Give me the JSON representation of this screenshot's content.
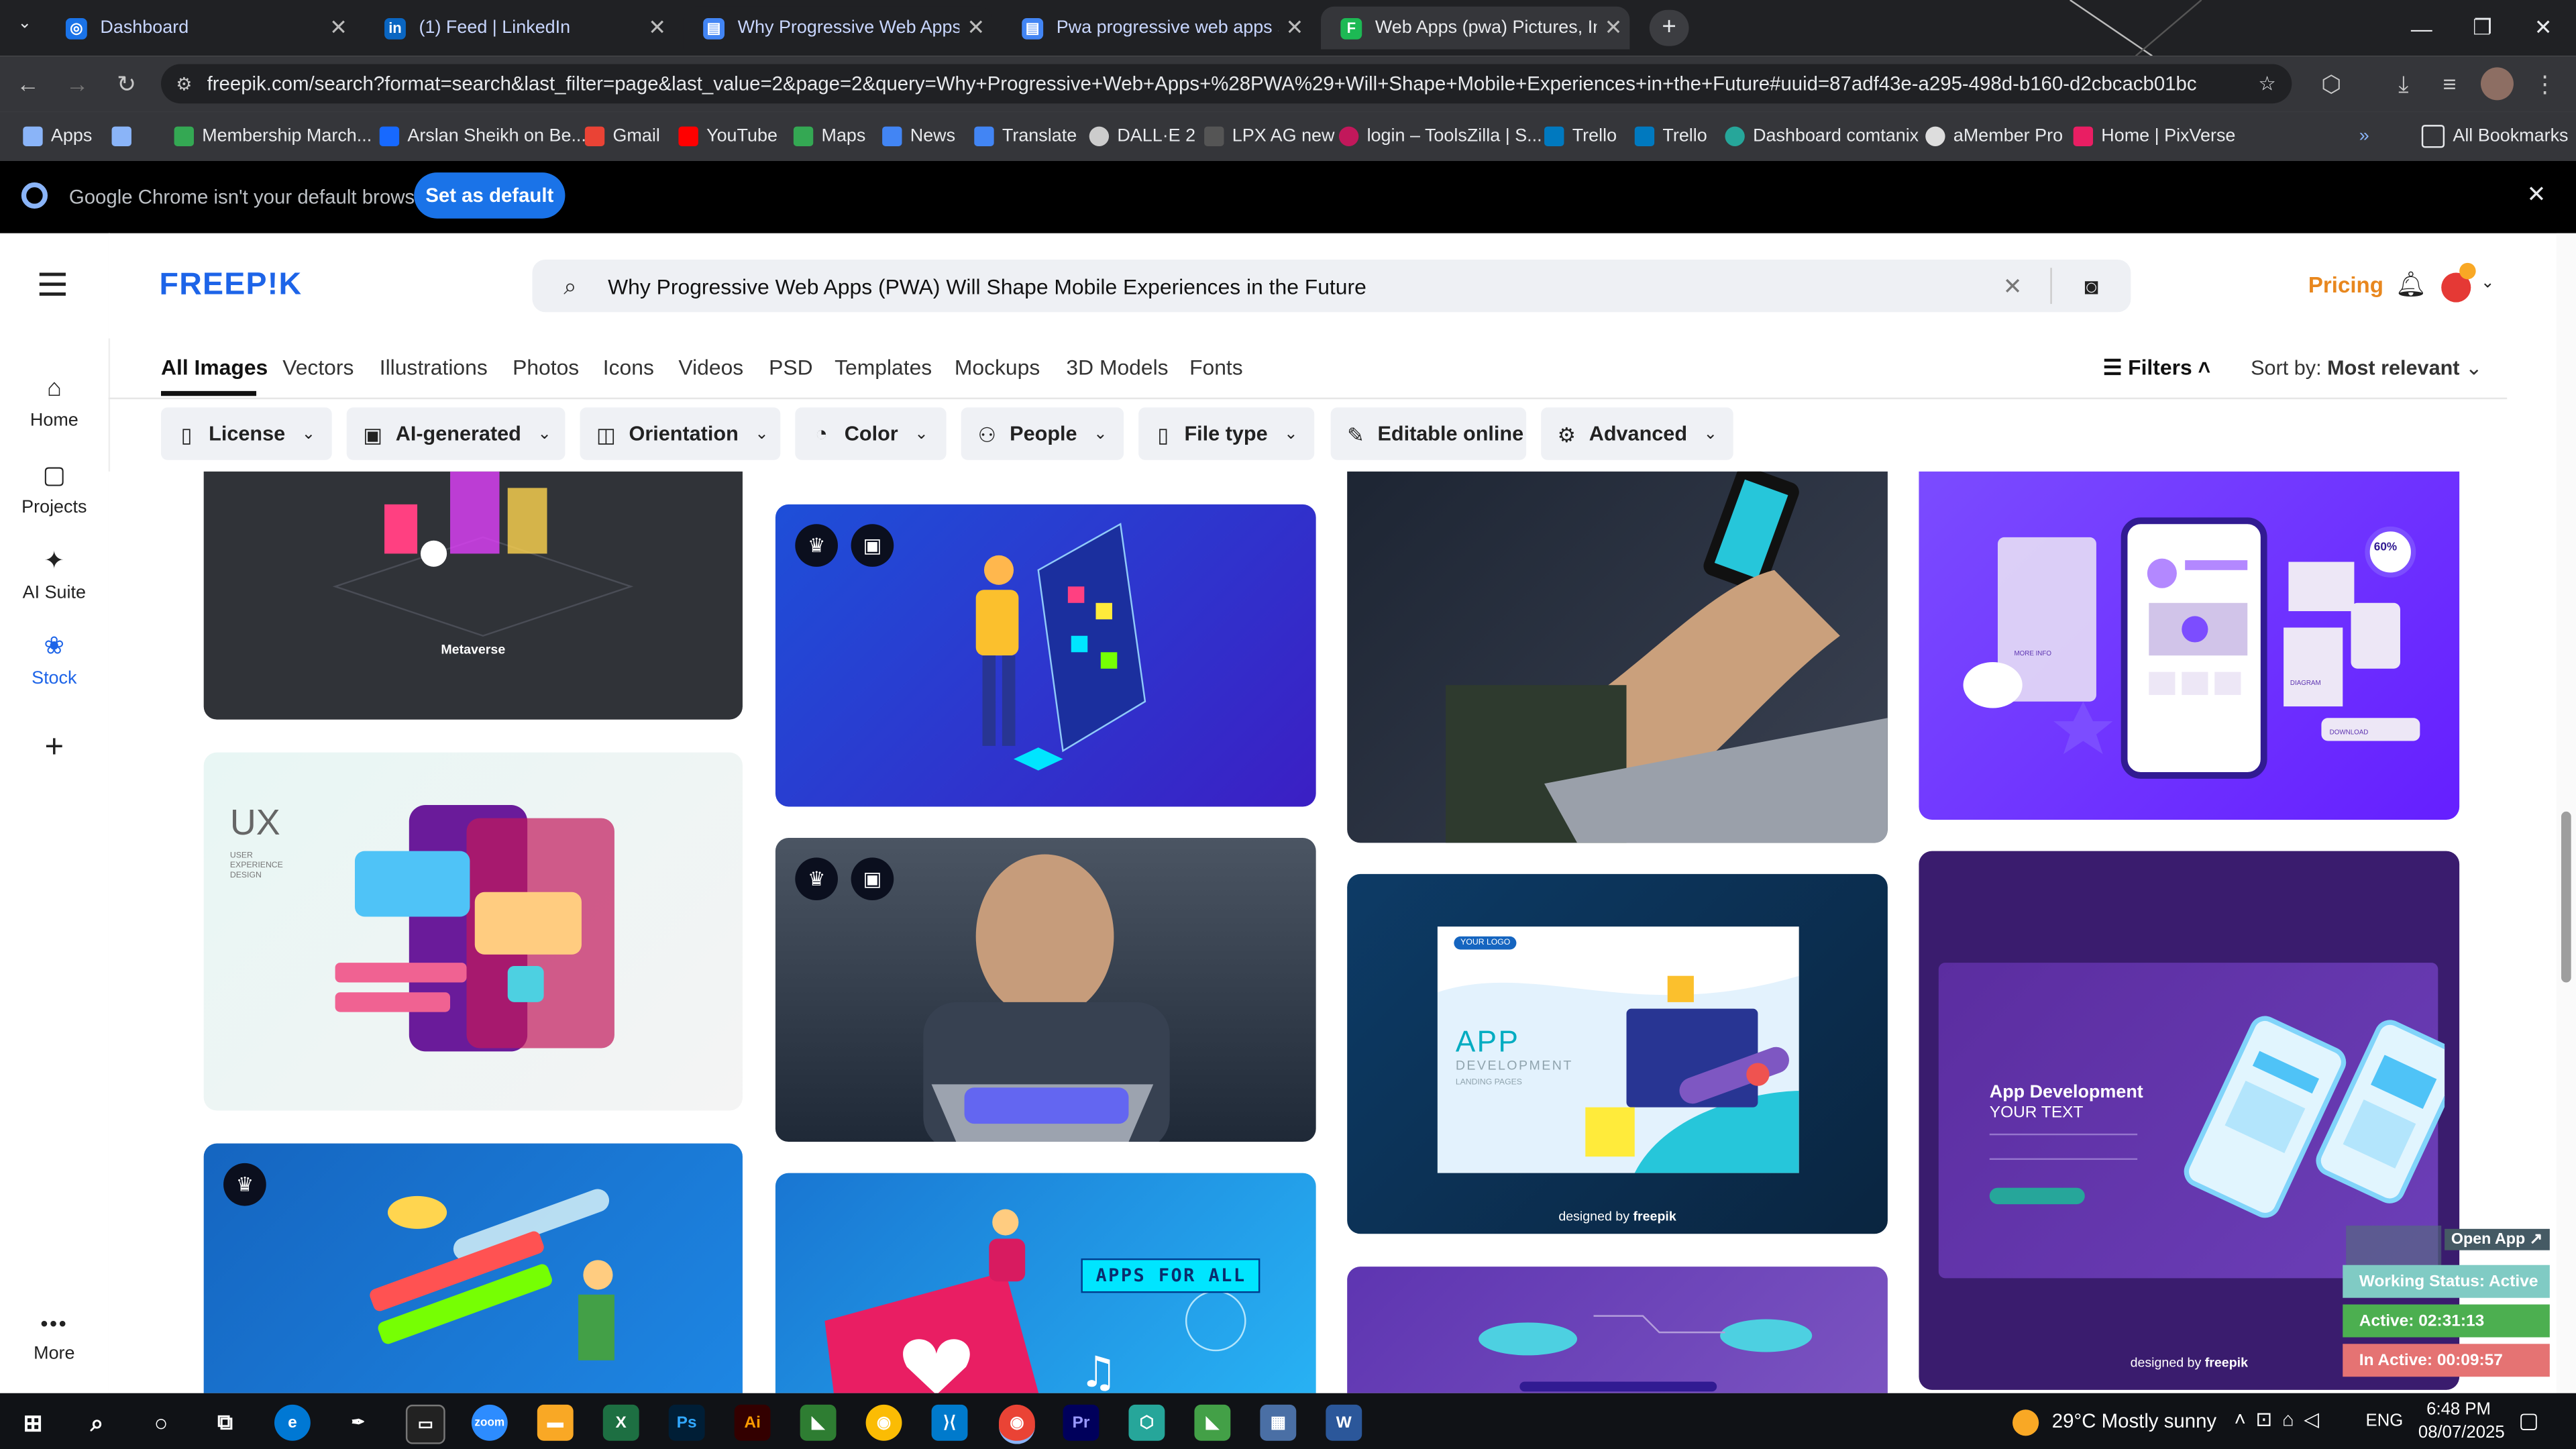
{
  "browser": {
    "tabs": [
      {
        "title": "Dashboard",
        "color": "#1a73e8",
        "glyph": "◎",
        "active": false
      },
      {
        "title": "(1) Feed | LinkedIn",
        "color": "#0a66c2",
        "glyph": "in",
        "active": false
      },
      {
        "title": "Why Progressive Web Apps (PW",
        "color": "#4285f4",
        "glyph": "▤",
        "active": true
      },
      {
        "title": "Pwa progressive web apps sma",
        "color": "#4285f4",
        "glyph": "▤",
        "active": false
      },
      {
        "title": "Web Apps (pwa) Pictures, Imag",
        "color": "#1db954",
        "glyph": "F",
        "active": false
      }
    ],
    "url": "freepik.com/search?format=search&last_filter=page&last_value=2&page=2&query=Why+Progressive+Web+Apps+%28PWA%29+Will+Shape+Mobile+Experiences+in+the+Future#uuid=87adf43e-a295-498d-b160-d2cbcacb01bc",
    "bookmarks": [
      {
        "label": "Apps",
        "color": "#8ab4f8"
      },
      {
        "label": "",
        "color": "#8ab4f8"
      },
      {
        "label": "Membership March...",
        "color": "#34a853"
      },
      {
        "label": "Arslan Sheikh on Be...",
        "color": "#1769ff"
      },
      {
        "label": "Gmail",
        "color": "#ea4335"
      },
      {
        "label": "YouTube",
        "color": "#ff0000"
      },
      {
        "label": "Maps",
        "color": "#34a853"
      },
      {
        "label": "News",
        "color": "#4285f4"
      },
      {
        "label": "Translate",
        "color": "#4285f4"
      },
      {
        "label": "DALL·E 2",
        "color": "#cccccc"
      },
      {
        "label": "LPX AG new",
        "color": "#888888"
      },
      {
        "label": "login – ToolsZilla | S...",
        "color": "#c2185b"
      },
      {
        "label": "Trello",
        "color": "#0079bf"
      },
      {
        "label": "Trello",
        "color": "#0079bf"
      },
      {
        "label": "Dashboard comtanix",
        "color": "#26a69a"
      },
      {
        "label": "aMember Pro",
        "color": "#dddddd"
      },
      {
        "label": "Home | PixVerse",
        "color": "#e91e63"
      }
    ],
    "all_bookmarks": "All Bookmarks",
    "infobar_text": "Google Chrome isn't your default browser",
    "set_default": "Set as default"
  },
  "freepik": {
    "logo": "FREEP!K",
    "search_value": "Why Progressive Web Apps (PWA) Will Shape Mobile Experiences in the Future",
    "pricing": "Pricing",
    "sidebar": [
      {
        "label": "Home",
        "icon": "⌂"
      },
      {
        "label": "Projects",
        "icon": "▢"
      },
      {
        "label": "AI Suite",
        "icon": "✦"
      },
      {
        "label": "Stock",
        "icon": "❀"
      }
    ],
    "more": "More",
    "categories": [
      "All Images",
      "Vectors",
      "Illustrations",
      "Photos",
      "Icons",
      "Videos",
      "PSD",
      "Templates",
      "Mockups",
      "3D Models",
      "Fonts"
    ],
    "filters_label": "Filters",
    "sort_label": "Sort by:",
    "sort_value": "Most relevant",
    "chips": [
      {
        "label": "License",
        "icon": "▯"
      },
      {
        "label": "AI-generated",
        "icon": "▣"
      },
      {
        "label": "Orientation",
        "icon": "◫"
      },
      {
        "label": "Color",
        "icon": "◔"
      },
      {
        "label": "People",
        "icon": "⚇"
      },
      {
        "label": "File type",
        "icon": "▯"
      },
      {
        "label": "Editable online",
        "icon": "✎"
      },
      {
        "label": "Advanced",
        "icon": "⚙"
      }
    ],
    "cards": {
      "metaverse_caption": "Metaverse",
      "ux_title": "UX",
      "ux_sub": "USER EXPERIENCE DESIGN",
      "apps_for_all": "APPS FOR ALL",
      "app_dev": "APP",
      "app_dev_sub": "DEVELOPMENT",
      "landing_pages": "LANDING PAGES",
      "your_logo": "YOUR LOGO",
      "app_dev_title": "App Development",
      "your_text": "YOUR TEXT",
      "designed_by": "designed by",
      "freepik_brand": "freepik",
      "percent": "60%",
      "more_info": "MORE INFO",
      "diagram": "DIAGRAM",
      "download": "DOWNLOAD"
    }
  },
  "widget": {
    "open_app": "Open App ↗",
    "working_status": "Working Status: Active",
    "active": "Active: 02:31:13",
    "inactive": "In Active: 00:09:57"
  },
  "taskbar": {
    "weather": "29°C  Mostly sunny",
    "lang": "ENG",
    "time": "6:48 PM",
    "date": "08/07/2025"
  }
}
